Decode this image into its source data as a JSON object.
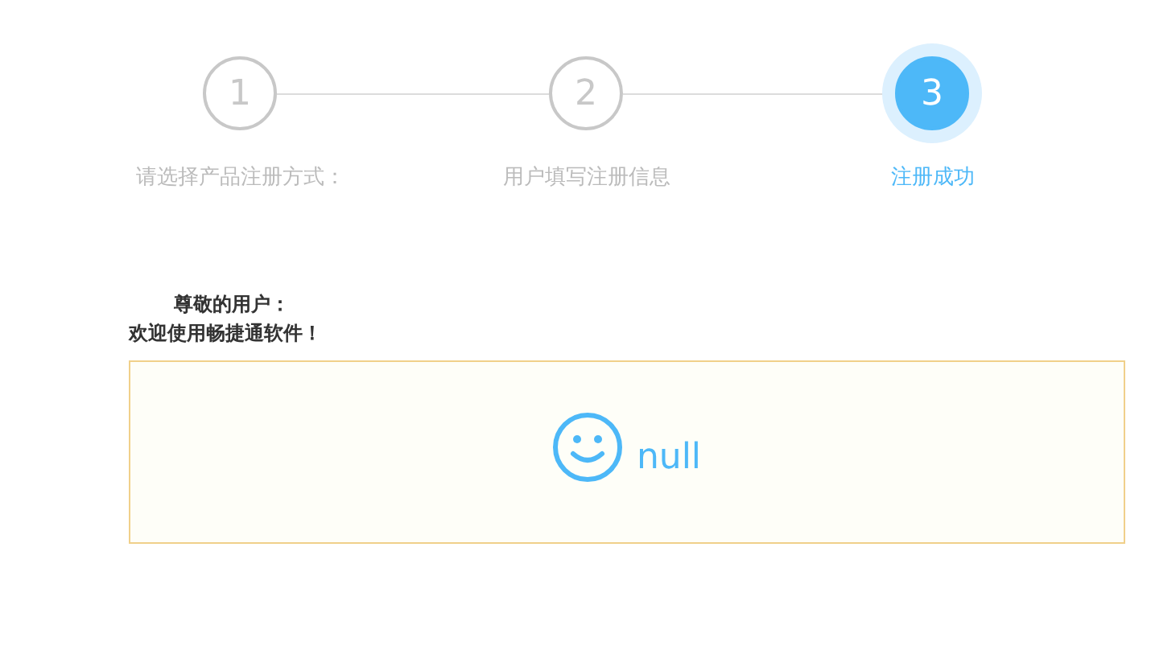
{
  "steps": [
    {
      "number": "1",
      "label": "请选择产品注册方式：",
      "selected": false
    },
    {
      "number": "2",
      "label": "用户填写注册信息",
      "selected": false
    },
    {
      "number": "3",
      "label": "注册成功",
      "selected": true
    }
  ],
  "greeting": "尊敬的用户：",
  "welcome": "欢迎使用畅捷通软件！",
  "result": {
    "text": "null"
  }
}
